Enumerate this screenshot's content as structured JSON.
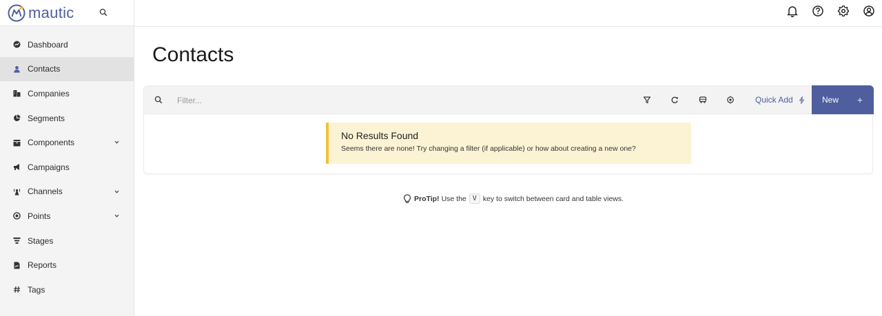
{
  "brand": {
    "name": "mautic",
    "accent": "#4e5e9e",
    "logo_accent": "#f1b02e"
  },
  "sidebar": {
    "items": [
      {
        "label": "Dashboard",
        "icon": "dashboard-icon"
      },
      {
        "label": "Contacts",
        "icon": "user-icon",
        "active": true
      },
      {
        "label": "Companies",
        "icon": "building-icon"
      },
      {
        "label": "Segments",
        "icon": "pie-chart-icon"
      },
      {
        "label": "Components",
        "icon": "box-icon",
        "expandable": true
      },
      {
        "label": "Campaigns",
        "icon": "megaphone-icon"
      },
      {
        "label": "Channels",
        "icon": "broadcast-icon",
        "expandable": true
      },
      {
        "label": "Points",
        "icon": "target-icon",
        "expandable": true
      },
      {
        "label": "Stages",
        "icon": "funnel-icon"
      },
      {
        "label": "Reports",
        "icon": "report-icon"
      },
      {
        "label": "Tags",
        "icon": "hashtag-icon"
      }
    ]
  },
  "topbar": {
    "icons": [
      "bell-icon",
      "help-icon",
      "gear-icon",
      "user-circle-icon"
    ]
  },
  "main": {
    "title": "Contacts",
    "toolbar": {
      "filter_placeholder": "Filter...",
      "quick_add_label": "Quick Add",
      "new_label": "New",
      "new_plus": "+"
    },
    "alert": {
      "title": "No Results Found",
      "text": "Seems there are none! Try changing a filter (if applicable) or how about creating a new one?",
      "color": "#fcf3d4",
      "border_color": "#f1c232"
    },
    "protip": {
      "label": "ProTip!",
      "before": "Use the",
      "key": "V",
      "after": "key to switch between card and table views."
    }
  }
}
